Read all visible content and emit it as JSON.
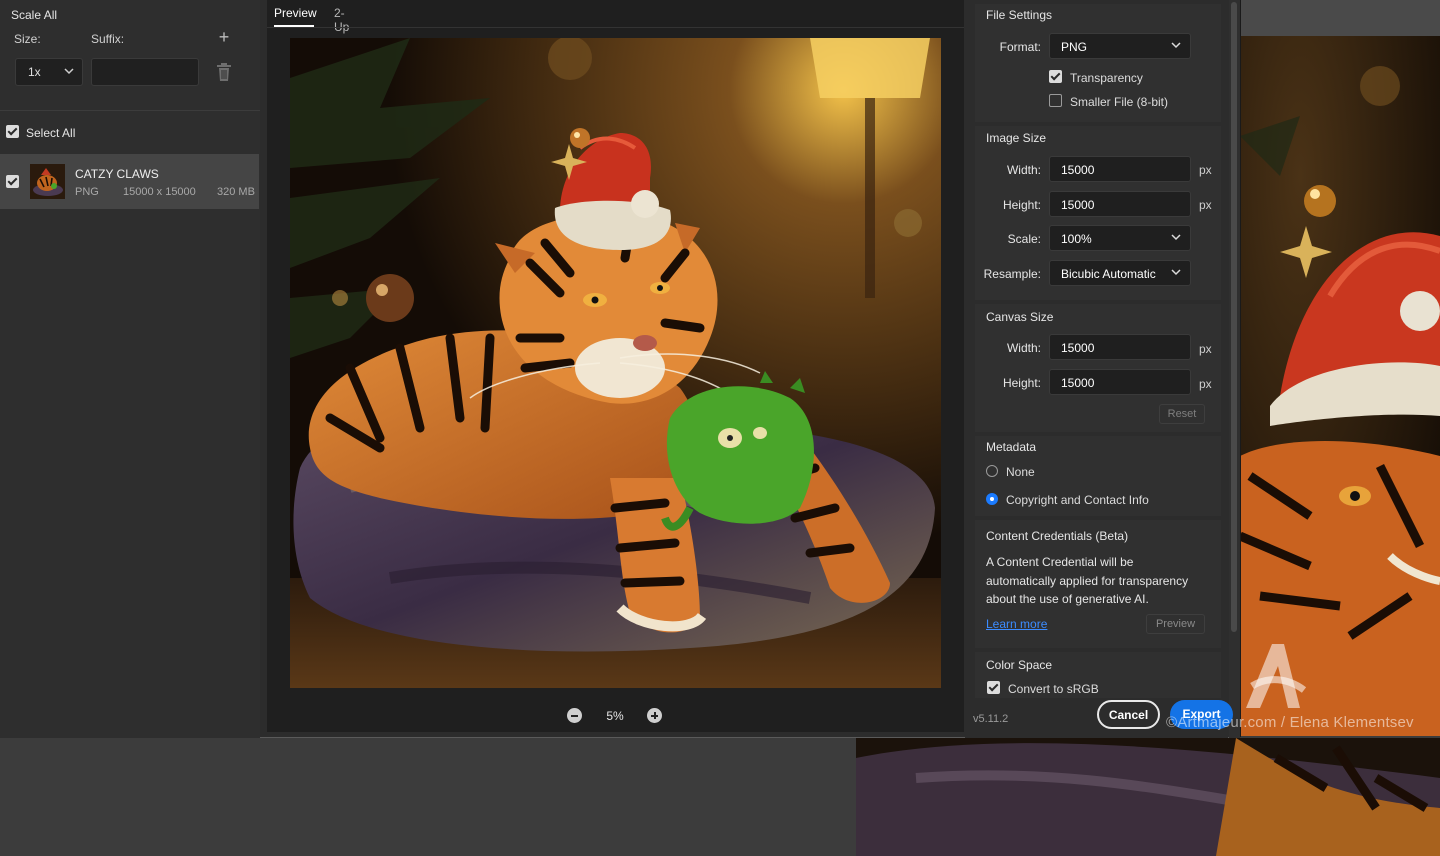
{
  "left_panel": {
    "title": "Scale All",
    "size_label": "Size:",
    "suffix_label": "Suffix:",
    "scale_value": "1x",
    "suffix_value": "",
    "select_all_label": "Select All",
    "select_all_checked": true,
    "asset": {
      "name": "CATZY CLAWS",
      "format": "PNG",
      "dimensions": "15000 x 15000",
      "file_size": "320 MB",
      "checked": true
    }
  },
  "preview": {
    "tabs": [
      {
        "label": "Preview",
        "active": true
      },
      {
        "label": "2-Up",
        "active": false
      }
    ],
    "zoom_level": "5%"
  },
  "file_settings": {
    "title": "File Settings",
    "format_label": "Format:",
    "format_value": "PNG",
    "transparency_label": "Transparency",
    "transparency_checked": true,
    "smaller_file_label": "Smaller File (8-bit)",
    "smaller_file_checked": false
  },
  "image_size": {
    "title": "Image Size",
    "width_label": "Width:",
    "width_value": "15000",
    "height_label": "Height:",
    "height_value": "15000",
    "unit": "px",
    "scale_label": "Scale:",
    "scale_value": "100%",
    "resample_label": "Resample:",
    "resample_value": "Bicubic Automatic"
  },
  "canvas_size": {
    "title": "Canvas Size",
    "width_label": "Width:",
    "width_value": "15000",
    "height_label": "Height:",
    "height_value": "15000",
    "unit": "px",
    "reset_label": "Reset"
  },
  "metadata": {
    "title": "Metadata",
    "options": [
      {
        "label": "None",
        "selected": false
      },
      {
        "label": "Copyright and Contact Info",
        "selected": true
      }
    ]
  },
  "content_credentials": {
    "title": "Content Credentials (Beta)",
    "description": "A Content Credential will be automatically applied for transparency about the use of generative AI.",
    "learn_more_label": "Learn more",
    "preview_label": "Preview"
  },
  "color_space": {
    "title": "Color Space",
    "convert_label": "Convert to sRGB",
    "convert_checked": true
  },
  "footer": {
    "version": "v5.11.2",
    "cancel_label": "Cancel",
    "export_label": "Export"
  },
  "watermark": {
    "text": "©Artmajeur.com / Elena Klementsev"
  },
  "colors": {
    "accent": "#1473e6",
    "link": "#3c8cff",
    "panel_bg": "#2c2c2c",
    "preview_bg": "#1f1f1f"
  }
}
